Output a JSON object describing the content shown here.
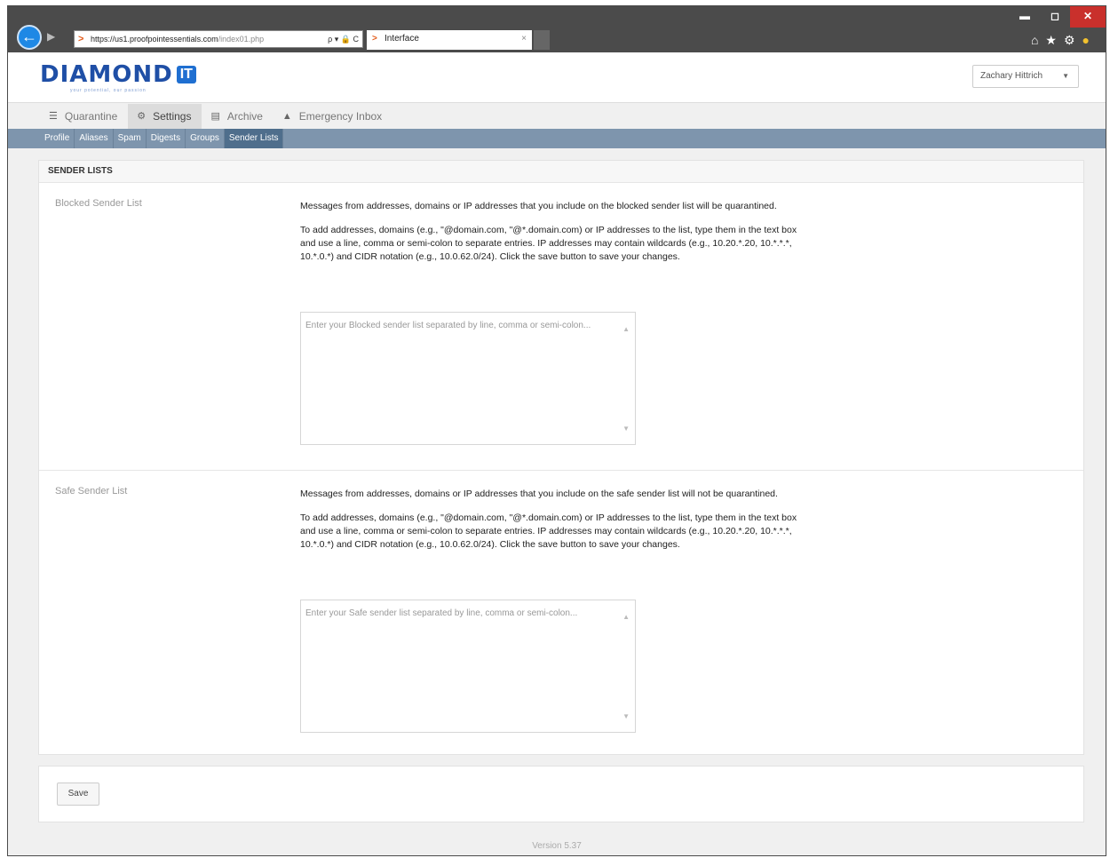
{
  "browser": {
    "url_host": "https://us1.proofpointessentials.com",
    "url_path": "/index01.php",
    "url_tools": "ρ ▾ 🔒 C",
    "tab_title": "Interface",
    "tab_close": "×",
    "minimize": "▬",
    "maximize": "◻",
    "close": "✕"
  },
  "header": {
    "logo_text": "DIAMOND",
    "logo_badge": "IT",
    "logo_sub": "your potential, our passion",
    "user_name": "Zachary Hittrich"
  },
  "main_nav": [
    {
      "label": "Quarantine",
      "icon": "list-icon"
    },
    {
      "label": "Settings",
      "icon": "gear-icon"
    },
    {
      "label": "Archive",
      "icon": "archive-icon"
    },
    {
      "label": "Emergency Inbox",
      "icon": "inbox-icon"
    }
  ],
  "sub_nav": [
    {
      "label": "Profile"
    },
    {
      "label": "Aliases"
    },
    {
      "label": "Spam"
    },
    {
      "label": "Digests"
    },
    {
      "label": "Groups"
    },
    {
      "label": "Sender Lists"
    }
  ],
  "panel": {
    "title": "SENDER LISTS",
    "blocked": {
      "label": "Blocked Sender List",
      "desc1": "Messages from addresses, domains or IP addresses that you include on the blocked sender list will be quarantined.",
      "desc2": "To add addresses, domains (e.g., \"@domain.com, \"@*.domain.com) or IP addresses to the list, type them in the text box and use a line, comma or semi-colon to separate entries. IP addresses may contain wildcards (e.g., 10.20.*.20, 10.*.*.*, 10.*.0.*) and CIDR notation (e.g., 10.0.62.0/24). Click the save button to save your changes.",
      "placeholder": "Enter your Blocked sender list separated by line, comma or semi-colon..."
    },
    "safe": {
      "label": "Safe Sender List",
      "desc1": "Messages from addresses, domains or IP addresses that you include on the safe sender list will not be quarantined.",
      "desc2": "To add addresses, domains (e.g., \"@domain.com, \"@*.domain.com) or IP addresses to the list, type them in the text box and use a line, comma or semi-colon to separate entries. IP addresses may contain wildcards (e.g., 10.20.*.20, 10.*.*.*, 10.*.0.*) and CIDR notation (e.g., 10.0.62.0/24). Click the save button to save your changes.",
      "placeholder": "Enter your Safe sender list separated by line, comma or semi-colon..."
    }
  },
  "save_label": "Save",
  "version": "Version 5.37",
  "colors": {
    "subnav_bg": "#7e95ad",
    "subnav_active": "#4f6e8c",
    "logo_blue": "#1f4fa6"
  }
}
